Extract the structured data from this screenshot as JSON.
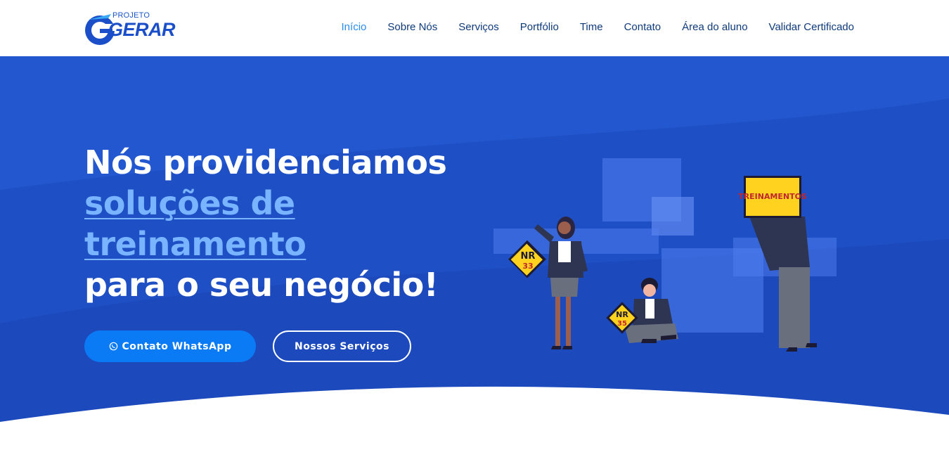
{
  "brand": {
    "small": "PROJETO",
    "big": "GERAR"
  },
  "nav": {
    "items": [
      {
        "label": "Início",
        "active": true
      },
      {
        "label": "Sobre Nós"
      },
      {
        "label": "Serviços"
      },
      {
        "label": "Portfólio"
      },
      {
        "label": "Time"
      },
      {
        "label": "Contato"
      },
      {
        "label": "Área do aluno"
      },
      {
        "label": "Validar Certificado"
      }
    ]
  },
  "hero": {
    "line1": "Nós providenciamos",
    "line2": "soluções de",
    "line3": "treinamento",
    "line4": "para o seu negócio!",
    "btn_whatsapp": "Contato WhatsApp",
    "btn_services": "Nossos Serviços"
  },
  "illustration": {
    "sign1": "NR",
    "sign1_num": "33",
    "sign2": "NR",
    "sign2_num": "35",
    "board": "TREINAMENTOS"
  },
  "colors": {
    "hero_bg": "#1e4fc4",
    "accent_text": "#78b4ff",
    "nav_active": "#2a8bf0",
    "nav_text": "#0f3a7a",
    "button_primary": "#0a7bf5",
    "sign_yellow": "#ffd21f"
  },
  "icons": [
    "whatsapp-icon"
  ]
}
